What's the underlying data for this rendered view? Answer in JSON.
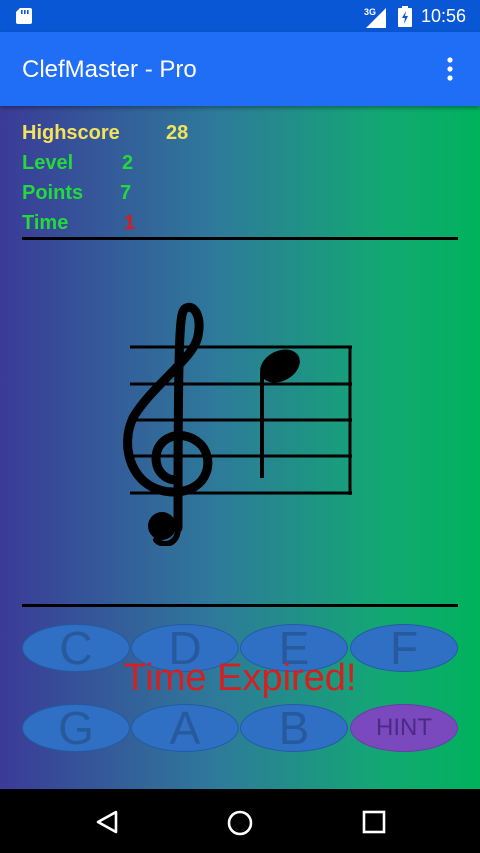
{
  "status_bar": {
    "network": "3G",
    "time": "10:56"
  },
  "app_bar": {
    "title": "ClefMaster - Pro"
  },
  "stats": {
    "highscore": {
      "label": "Highscore",
      "value": "28"
    },
    "level": {
      "label": "Level",
      "value": "2"
    },
    "points": {
      "label": "Points",
      "value": "7"
    },
    "time": {
      "label": "Time",
      "value": "1"
    }
  },
  "staff": {
    "clef": "treble-clef-icon",
    "note": "eighth-note-icon"
  },
  "buttons": {
    "row1": [
      "C",
      "D",
      "E",
      "F"
    ],
    "row2": [
      "G",
      "A",
      "B"
    ],
    "hint": "HINT"
  },
  "message": "Time Expired!",
  "colors": {
    "app_bar": "#1f6ef5",
    "status_bar": "#0a57d6",
    "highscore": "#f4e35a",
    "stat_green": "#23d93c",
    "time_value": "#e01818",
    "note_button": "#2f6fc4",
    "hint_button": "#7a49bd",
    "message": "#d42020"
  }
}
